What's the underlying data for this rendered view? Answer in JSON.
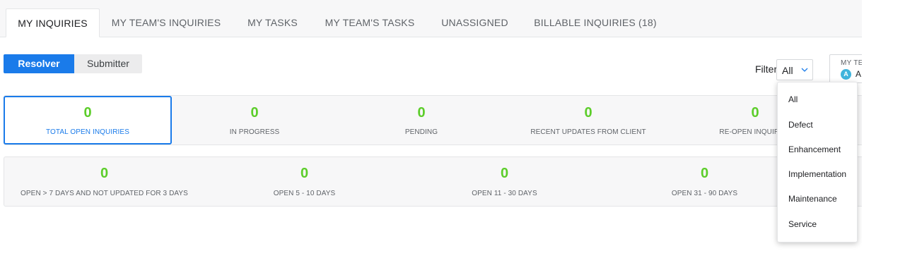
{
  "tabs": [
    {
      "label": "MY INQUIRIES",
      "active": true
    },
    {
      "label": "MY TEAM'S INQUIRIES",
      "active": false
    },
    {
      "label": "MY TASKS",
      "active": false
    },
    {
      "label": "MY TEAM'S TASKS",
      "active": false
    },
    {
      "label": "UNASSIGNED",
      "active": false
    },
    {
      "label": "BILLABLE INQUIRIES (18)",
      "active": false
    }
  ],
  "role_toggle": {
    "resolver_label": "Resolver",
    "submitter_label": "Submitter",
    "selected": "Resolver"
  },
  "filter": {
    "label": "Filter by:",
    "value": "All",
    "icon": "chevron-down-icon"
  },
  "team_selector": {
    "label": "MY TE",
    "avatar_initial": "A",
    "value_partial": "A"
  },
  "summary_row": [
    {
      "count": "0",
      "label": "TOTAL OPEN INQUIRIES",
      "selected": true
    },
    {
      "count": "0",
      "label": "IN PROGRESS",
      "selected": false
    },
    {
      "count": "0",
      "label": "PENDING",
      "selected": false
    },
    {
      "count": "0",
      "label": "RECENT UPDATES FROM CLIENT",
      "selected": false
    },
    {
      "count": "0",
      "label": "RE-OPEN INQUIRIES",
      "selected": false
    }
  ],
  "aging_row": [
    {
      "count": "0",
      "label": "OPEN > 7 DAYS AND NOT UPDATED FOR 3 DAYS"
    },
    {
      "count": "0",
      "label": "OPEN 5 - 10 DAYS"
    },
    {
      "count": "0",
      "label": "OPEN 11 - 30 DAYS"
    },
    {
      "count": "0",
      "label": "OPEN 31 - 90 DAYS"
    }
  ],
  "filter_options": [
    "All",
    "Defect",
    "Enhancement",
    "Implementation",
    "Maintenance",
    "Service"
  ],
  "colors": {
    "accent": "#1a7bea",
    "count_green": "#5ccd2a",
    "tab_bg": "#f7f7f8",
    "avatar": "#3fb4dc"
  }
}
